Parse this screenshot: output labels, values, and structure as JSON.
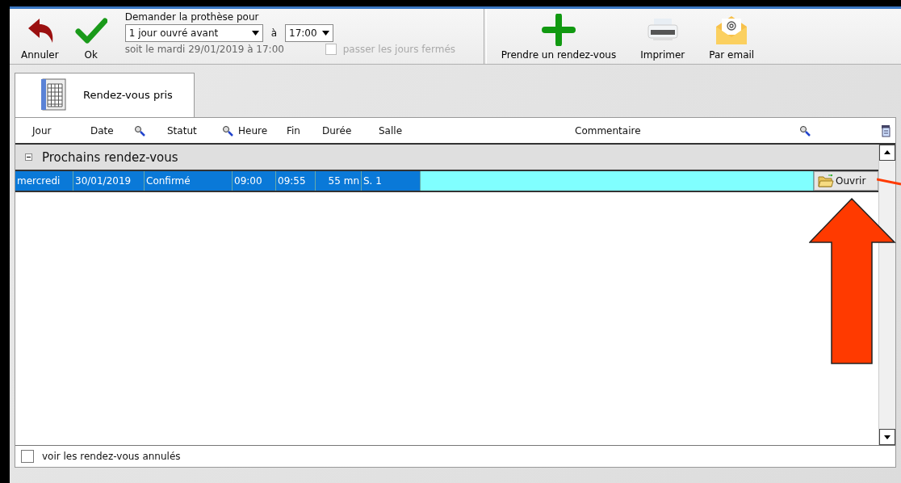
{
  "toolbar": {
    "left_buttons": [
      {
        "label": "Annuler",
        "kind": "undo"
      },
      {
        "label": "Ok",
        "kind": "check"
      }
    ],
    "request": {
      "label": "Demander la prothèse pour",
      "delay": "1 jour ouvré avant",
      "at": "à",
      "time": "17:00",
      "summary": "soit le mardi 29/01/2019 à 17:00",
      "skip_closed": {
        "label": "passer les jours fermés",
        "checked": false,
        "disabled": true
      }
    },
    "right_buttons": [
      {
        "label": "Prendre un rendez-vous",
        "kind": "plus"
      },
      {
        "label": "Imprimer",
        "kind": "printer"
      },
      {
        "label": "Par email",
        "kind": "mail"
      }
    ]
  },
  "tabs": [
    {
      "label": "Rendez-vous pris",
      "selected": true
    }
  ],
  "table": {
    "header": [
      {
        "kind": "label",
        "label": "Jour"
      },
      {
        "kind": "label",
        "label": "Date"
      },
      {
        "kind": "search"
      },
      {
        "kind": "label",
        "label": "Statut"
      },
      {
        "kind": "search"
      },
      {
        "kind": "label",
        "label": "Heure"
      },
      {
        "kind": "label",
        "label": "Fin"
      },
      {
        "kind": "label",
        "label": "Durée"
      },
      {
        "kind": "label",
        "label": "Salle"
      },
      {
        "kind": "label",
        "label": "Commentaire"
      },
      {
        "kind": "search"
      }
    ],
    "groups": [
      {
        "label": "Prochains rendez-vous",
        "expanded": true,
        "rows": [
          {
            "cells": [
              "mercredi",
              "30/01/2019",
              "Confirmé",
              "09:00",
              "09:55",
              "55 mn",
              "S. 1",
              ""
            ],
            "selected": true,
            "action": "Ouvrir"
          }
        ]
      }
    ]
  },
  "show_cancelled": {
    "label": "voir les rendez-vous annulés",
    "checked": false
  }
}
